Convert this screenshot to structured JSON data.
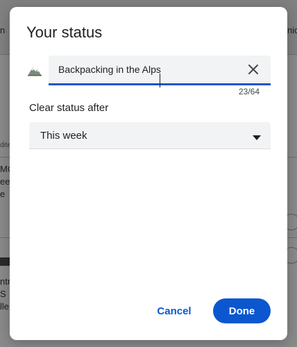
{
  "background": {
    "fragments": [
      "n",
      "nic",
      "dite",
      "MC",
      "ee",
      "e",
      "ntr",
      "S",
      "lle"
    ]
  },
  "dialog": {
    "title": "Your status",
    "emoji_icon": "mountain-icon",
    "status_input": {
      "value": "Backpacking in the Alps",
      "placeholder": ""
    },
    "counter": "23/64",
    "clear_label": "Clear status after",
    "duration": {
      "selected": "This week"
    },
    "cancel_label": "Cancel",
    "done_label": "Done"
  },
  "colors": {
    "accent": "#0b57d0",
    "field_bg": "#f1f3f4",
    "overlay": "#8a8a8a"
  }
}
